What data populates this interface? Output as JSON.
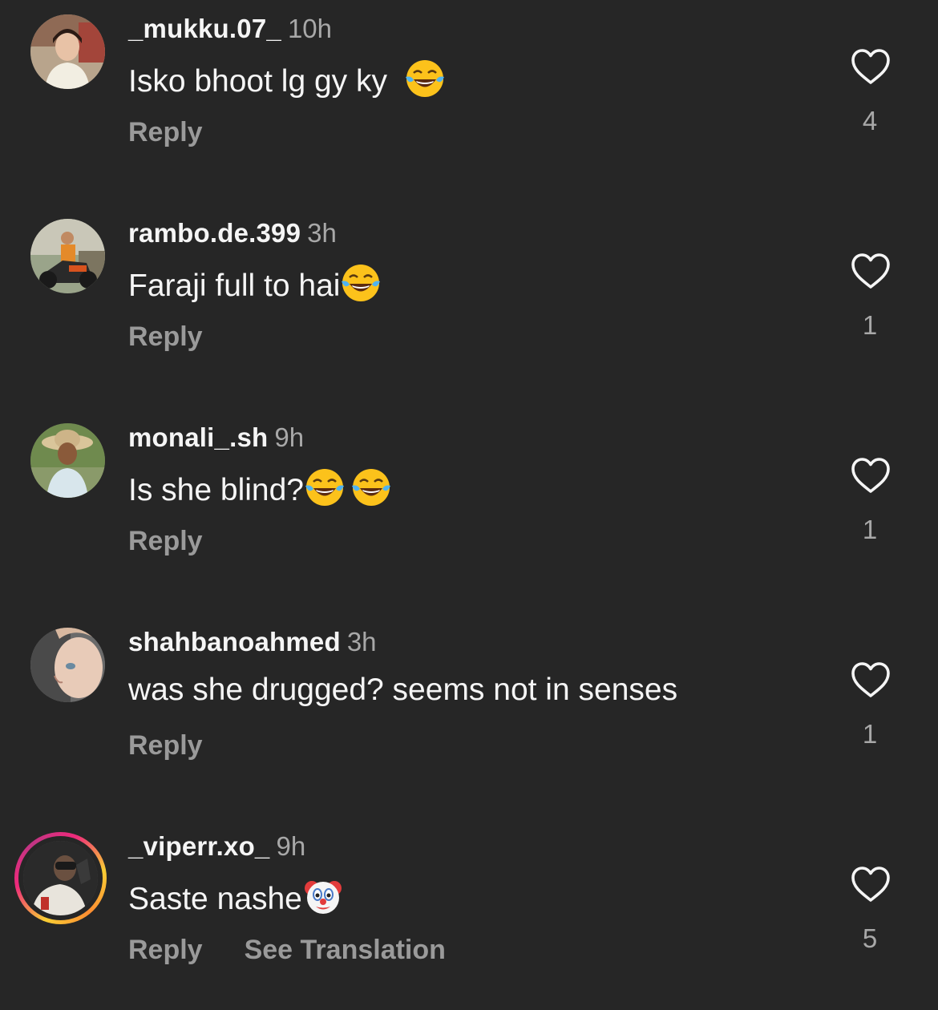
{
  "comments": [
    {
      "username": "_mukku.07_",
      "time": "10h",
      "text": "Isko bhoot lg gy ky",
      "emojis": [
        "face-with-tears-of-joy"
      ],
      "reply_label": "Reply",
      "like_count": "4",
      "has_story_ring": false
    },
    {
      "username": "rambo.de.399",
      "time": "3h",
      "text": "Faraji full to hai",
      "emojis": [
        "face-with-tears-of-joy"
      ],
      "reply_label": "Reply",
      "like_count": "1",
      "has_story_ring": false
    },
    {
      "username": "monali_.sh",
      "time": "9h",
      "text": "Is she blind?",
      "emojis": [
        "face-with-tears-of-joy",
        "face-with-tears-of-joy"
      ],
      "reply_label": "Reply",
      "like_count": "1",
      "has_story_ring": false
    },
    {
      "username": "shahbanoahmed",
      "time": "3h",
      "text": "was she drugged? seems not in senses",
      "emojis": [],
      "reply_label": "Reply",
      "like_count": "1",
      "has_story_ring": false
    },
    {
      "username": "_viperr.xo_",
      "time": "9h",
      "text": "Saste nashe",
      "emojis": [
        "clown-face"
      ],
      "reply_label": "Reply",
      "translation_label": "See Translation",
      "like_count": "5",
      "has_story_ring": true
    }
  ],
  "icons": {
    "like": "heart-outline-icon",
    "avatar": "profile-photo"
  },
  "colors": {
    "background": "#262626",
    "primary_text": "#f5f5f5",
    "secondary_text": "#a8a8a8",
    "action_text": "#9a9a9a"
  }
}
